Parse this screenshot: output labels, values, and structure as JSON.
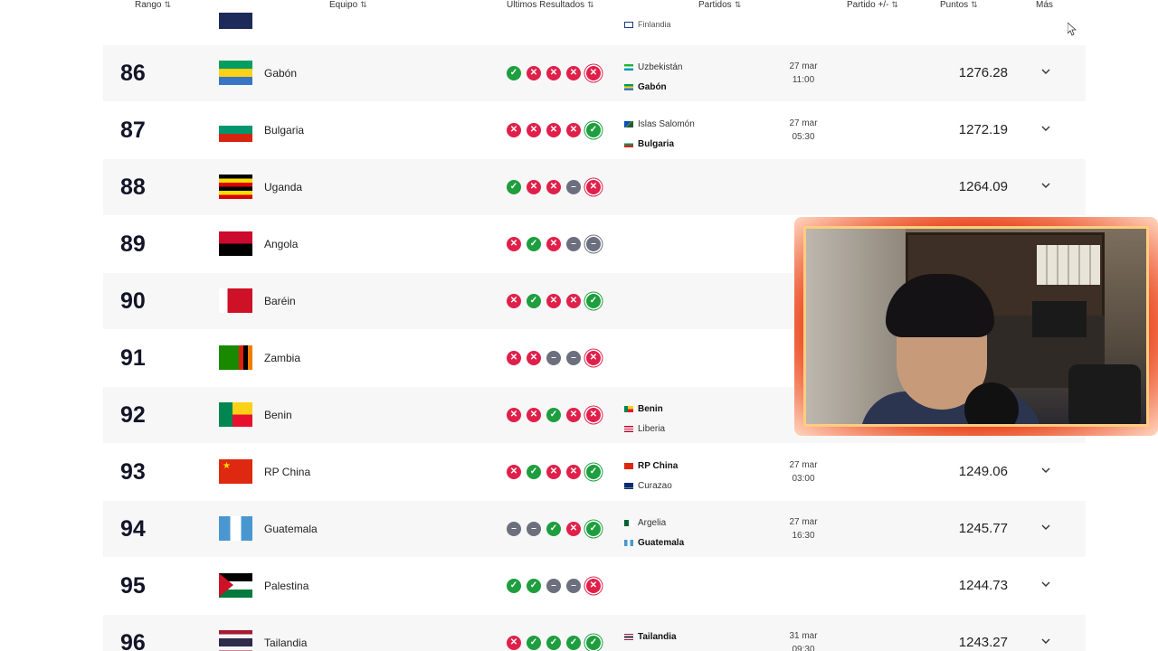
{
  "header": {
    "rank": "Rango",
    "team": "Equipo",
    "last_results": "Ultimos Resultados",
    "matches": "Partidos",
    "match_diff": "Partido +/-",
    "points": "Puntos",
    "more": "Más"
  },
  "partial_row": {
    "match_team": "Finlandia"
  },
  "colors": {
    "win": "#1e9e3e",
    "loss": "#e0204a",
    "draw": "#6c6f7d"
  },
  "rows": [
    {
      "rank": "86",
      "team": "Gabón",
      "results": [
        "W",
        "L",
        "L",
        "L",
        "L"
      ],
      "match": {
        "home": "Uzbekistán",
        "away": "Gabón",
        "bold": "away",
        "date": "27 mar",
        "time": "11:00"
      },
      "points": "1276.28"
    },
    {
      "rank": "87",
      "team": "Bulgaria",
      "results": [
        "L",
        "L",
        "L",
        "L",
        "W"
      ],
      "match": {
        "home": "Islas Salomón",
        "away": "Bulgaria",
        "bold": "away",
        "date": "27 mar",
        "time": "05:30"
      },
      "points": "1272.19"
    },
    {
      "rank": "88",
      "team": "Uganda",
      "results": [
        "W",
        "L",
        "L",
        "D",
        "L"
      ],
      "match": null,
      "points": "1264.09"
    },
    {
      "rank": "89",
      "team": "Angola",
      "results": [
        "L",
        "W",
        "L",
        "D",
        "D"
      ],
      "match": null,
      "points": ""
    },
    {
      "rank": "90",
      "team": "Baréin",
      "results": [
        "L",
        "W",
        "L",
        "L",
        "W"
      ],
      "match": null,
      "points": ""
    },
    {
      "rank": "91",
      "team": "Zambia",
      "results": [
        "L",
        "L",
        "D",
        "D",
        "L"
      ],
      "match": null,
      "points": ""
    },
    {
      "rank": "92",
      "team": "Benin",
      "results": [
        "L",
        "L",
        "W",
        "L",
        "L"
      ],
      "match": {
        "home": "Benin",
        "away": "Liberia",
        "bold": "home",
        "date": "",
        "time": ""
      },
      "points": ""
    },
    {
      "rank": "93",
      "team": "RP China",
      "results": [
        "L",
        "W",
        "L",
        "L",
        "W"
      ],
      "match": {
        "home": "RP China",
        "away": "Curazao",
        "bold": "home",
        "date": "27 mar",
        "time": "03:00"
      },
      "points": "1249.06"
    },
    {
      "rank": "94",
      "team": "Guatemala",
      "results": [
        "D",
        "D",
        "W",
        "L",
        "W"
      ],
      "match": {
        "home": "Argelia",
        "away": "Guatemala",
        "bold": "away",
        "date": "27 mar",
        "time": "16:30"
      },
      "points": "1245.77"
    },
    {
      "rank": "95",
      "team": "Palestina",
      "results": [
        "W",
        "W",
        "D",
        "D",
        "L"
      ],
      "match": null,
      "points": "1244.73"
    },
    {
      "rank": "96",
      "team": "Tailandia",
      "results": [
        "L",
        "W",
        "W",
        "W",
        "W"
      ],
      "match": {
        "home": "Tailandia",
        "away": "",
        "bold": "home",
        "date": "31 mar",
        "time": "09:30"
      },
      "points": "1243.27"
    }
  ]
}
